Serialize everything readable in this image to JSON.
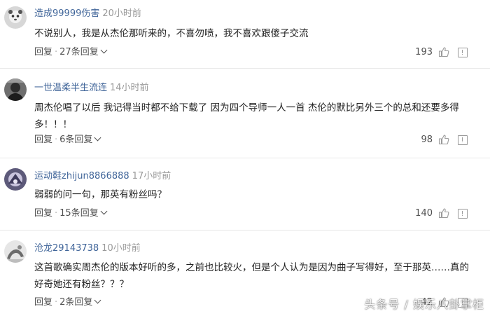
{
  "comments": [
    {
      "username": "造成99999伤害",
      "time": "20小时前",
      "text": "不说别人，我是从杰伦那听来的，不喜勿喷，我不喜欢跟傻子交流",
      "reply_label": "回复",
      "replies_label": "27条回复",
      "likes": "193"
    },
    {
      "username": "一世温柔半生流连",
      "time": "14小时前",
      "text": "周杰伦唱了以后 我记得当时都不给下载了 因为四个导师一人一首 杰伦的默比另外三个的总和还要多得多！！！",
      "reply_label": "回复",
      "replies_label": "6条回复",
      "likes": "98"
    },
    {
      "username": "运动鞋zhijun8866888",
      "time": "17小时前",
      "text": "弱弱的问一句，那英有粉丝吗？",
      "reply_label": "回复",
      "replies_label": "15条回复",
      "likes": "140"
    },
    {
      "username": "沧龙29143738",
      "time": "10小时前",
      "text": "这首歌确实周杰伦的版本好听的多，之前也比较火，但是个人认为是因为曲子写得好，至于那英……真的好奇她还有粉丝？？？",
      "reply_label": "回复",
      "replies_label": "2条回复",
      "likes": "42"
    }
  ],
  "watermark": "头条号 / 娱乐八卦掌柜",
  "colors": {
    "username": "#406599",
    "time": "#999999",
    "text": "#222222",
    "action": "#505050",
    "divider": "#e8e8e8"
  },
  "icons": [
    "avatar",
    "thumb-up-icon",
    "report-icon",
    "chevron-down-icon"
  ]
}
